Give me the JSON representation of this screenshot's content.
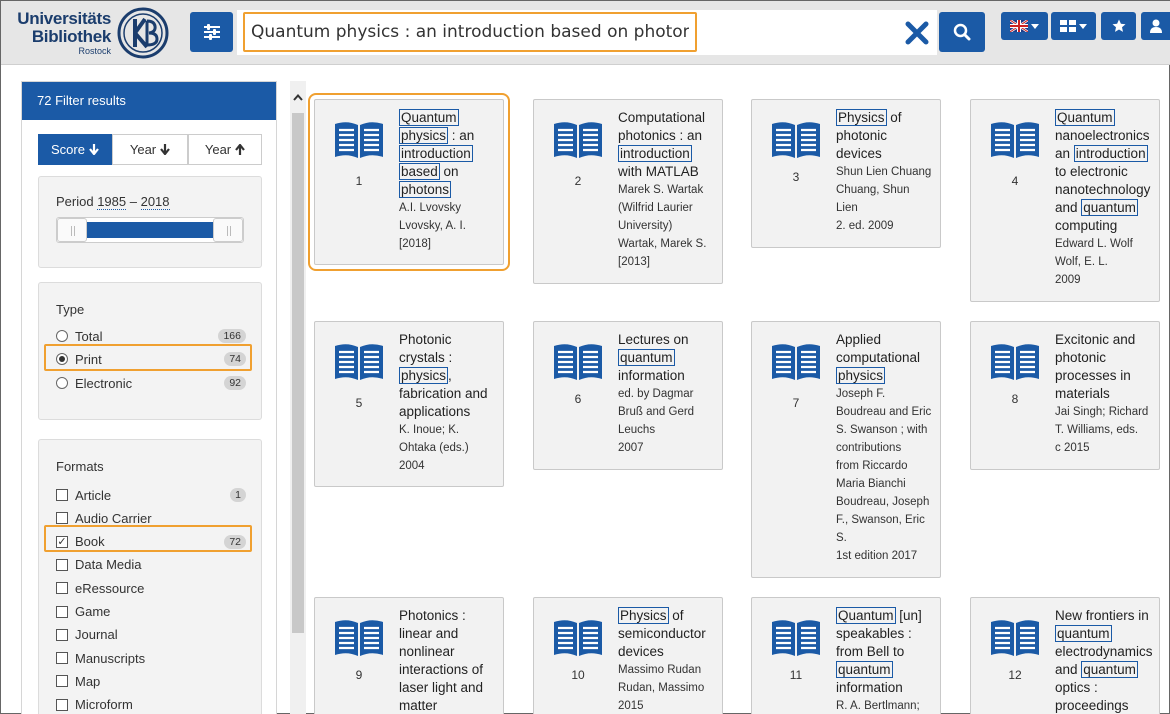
{
  "header": {
    "logo_line1": "Universitäts",
    "logo_line2": "Bibliothek",
    "logo_line3": "Rostock",
    "search_value": "Quantum physics : an introduction based on photons"
  },
  "sidebar": {
    "heading": "72 Filter results",
    "sort": [
      {
        "label": "Score",
        "active": true
      },
      {
        "label": "Year",
        "active": false
      },
      {
        "label": "Year",
        "active": false
      }
    ],
    "period": {
      "label": "Period",
      "from": "1985",
      "to": "2018"
    },
    "type": {
      "title": "Type",
      "options": [
        {
          "label": "Total",
          "count": "166",
          "selected": false
        },
        {
          "label": "Print",
          "count": "74",
          "selected": true
        },
        {
          "label": "Electronic",
          "count": "92",
          "selected": false
        }
      ]
    },
    "formats": {
      "title": "Formats",
      "options": [
        {
          "label": "Article",
          "count": "1",
          "checked": false
        },
        {
          "label": "Audio Carrier",
          "count": "",
          "checked": false
        },
        {
          "label": "Book",
          "count": "72",
          "checked": true
        },
        {
          "label": "Data Media",
          "count": "",
          "checked": false
        },
        {
          "label": "eRessource",
          "count": "",
          "checked": false
        },
        {
          "label": "Game",
          "count": "",
          "checked": false
        },
        {
          "label": "Journal",
          "count": "",
          "checked": false
        },
        {
          "label": "Manuscripts",
          "count": "",
          "checked": false
        },
        {
          "label": "Map",
          "count": "",
          "checked": false
        },
        {
          "label": "Microform",
          "count": "",
          "checked": false
        }
      ]
    }
  },
  "results": [
    {
      "num": "1",
      "title": [
        [
          "Quantum",
          true
        ],
        [
          " ",
          false
        ],
        [
          "physics",
          true
        ],
        [
          " : an ",
          false
        ],
        [
          "introduction",
          true
        ],
        [
          " ",
          false
        ],
        [
          "based",
          true
        ],
        [
          " on ",
          false
        ],
        [
          "photons",
          true
        ]
      ],
      "meta": [
        "A.I. Lvovsky",
        "Lvovsky, A. I.",
        "[2018]"
      ]
    },
    {
      "num": "2",
      "title": [
        [
          "Computational photonics : an ",
          false
        ],
        [
          "introduction",
          true
        ],
        [
          " with MATLAB",
          false
        ]
      ],
      "meta": [
        "Marek S. Wartak",
        "(Wilfrid Laurier",
        "University)",
        "Wartak, Marek S.",
        "[2013]"
      ]
    },
    {
      "num": "3",
      "title": [
        [
          "Physics",
          true
        ],
        [
          " of photonic devices",
          false
        ]
      ],
      "meta": [
        "Shun Lien Chuang",
        "Chuang, Shun",
        "Lien",
        "2. ed. 2009"
      ]
    },
    {
      "num": "4",
      "title": [
        [
          "Quantum",
          true
        ],
        [
          " nanoelectronics an ",
          false
        ],
        [
          "introduction",
          true
        ],
        [
          " to electronic nanotechnology and ",
          false
        ],
        [
          "quantum",
          true
        ],
        [
          " computing",
          false
        ]
      ],
      "meta": [
        "Edward L. Wolf",
        "Wolf, E. L.",
        "2009"
      ]
    },
    {
      "num": "5",
      "title": [
        [
          "Photonic crystals : ",
          false
        ],
        [
          "physics",
          true
        ],
        [
          ", fabrication and applications",
          false
        ]
      ],
      "meta": [
        "K. Inoue; K.",
        "Ohtaka (eds.)",
        "2004"
      ]
    },
    {
      "num": "6",
      "title": [
        [
          "Lectures on ",
          false
        ],
        [
          "quantum",
          true
        ],
        [
          " information",
          false
        ]
      ],
      "meta": [
        "ed. by Dagmar",
        "Bruß and Gerd",
        "Leuchs",
        "2007"
      ]
    },
    {
      "num": "7",
      "title": [
        [
          "Applied computational ",
          false
        ],
        [
          "physics",
          true
        ]
      ],
      "meta": [
        "Joseph F.",
        "Boudreau and Eric",
        "S. Swanson ; with",
        "contributions",
        "from Riccardo",
        "Maria Bianchi",
        "Boudreau, Joseph",
        "F., Swanson, Eric",
        "S.",
        "1st edition 2017"
      ]
    },
    {
      "num": "8",
      "title": [
        [
          "Excitonic and photonic processes in materials",
          false
        ]
      ],
      "meta": [
        "Jai Singh; Richard",
        "T. Williams, eds.",
        "c 2015"
      ]
    },
    {
      "num": "9",
      "title": [
        [
          "Photonics : linear and nonlinear interactions of laser light and matter",
          false
        ]
      ],
      "meta": []
    },
    {
      "num": "10",
      "title": [
        [
          "Physics",
          true
        ],
        [
          " of semiconductor devices",
          false
        ]
      ],
      "meta": [
        "Massimo Rudan",
        "Rudan, Massimo",
        "2015"
      ]
    },
    {
      "num": "11",
      "title": [
        [
          "Quantum",
          true
        ],
        [
          " [un] speakables : from Bell to ",
          false
        ],
        [
          "quantum",
          true
        ],
        [
          " information",
          false
        ]
      ],
      "meta": [
        "R. A. Bertlmann;"
      ]
    },
    {
      "num": "12",
      "title": [
        [
          "New frontiers in ",
          false
        ],
        [
          "quantum",
          true
        ],
        [
          " electrodynamics and ",
          false
        ],
        [
          "quantum",
          true
        ],
        [
          " optics : proceedings",
          false
        ]
      ],
      "meta": []
    }
  ]
}
